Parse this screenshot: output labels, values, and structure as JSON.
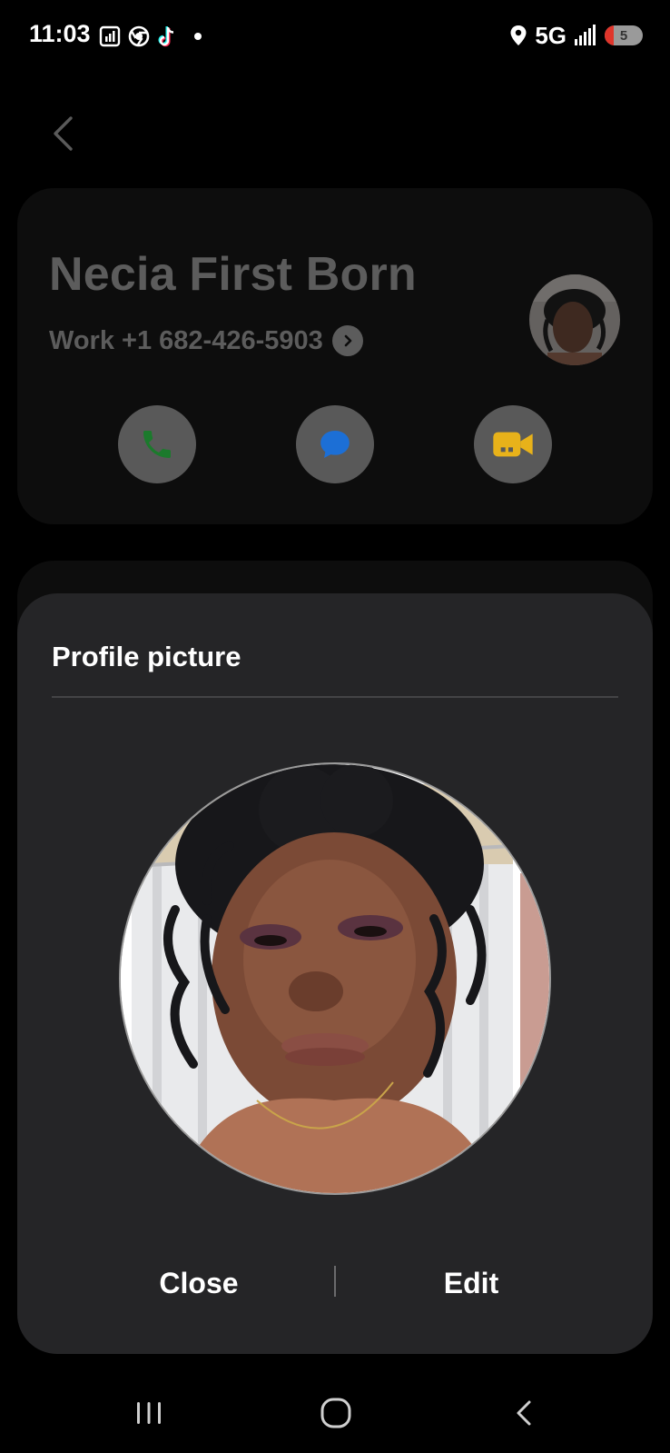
{
  "status_bar": {
    "time": "11:03",
    "network": "5G",
    "battery": "5",
    "icons": [
      "gallery-widget-icon",
      "chrome-icon",
      "tiktok-icon",
      "notification-dot-icon",
      "location-icon",
      "signal-icon",
      "battery-icon"
    ]
  },
  "contact": {
    "name": "Necia First Born",
    "number": "Work +1 682-426-5903",
    "actions": [
      "call-icon",
      "message-icon",
      "video-call-icon"
    ],
    "colors": {
      "call": "#1b7a2c",
      "message": "#1c6fd6",
      "video": "#e8b21a"
    }
  },
  "sheet": {
    "title": "Profile picture",
    "close_label": "Close",
    "edit_label": "Edit"
  },
  "nav": {
    "icons": [
      "recent-apps-icon",
      "home-icon",
      "back-icon"
    ]
  }
}
